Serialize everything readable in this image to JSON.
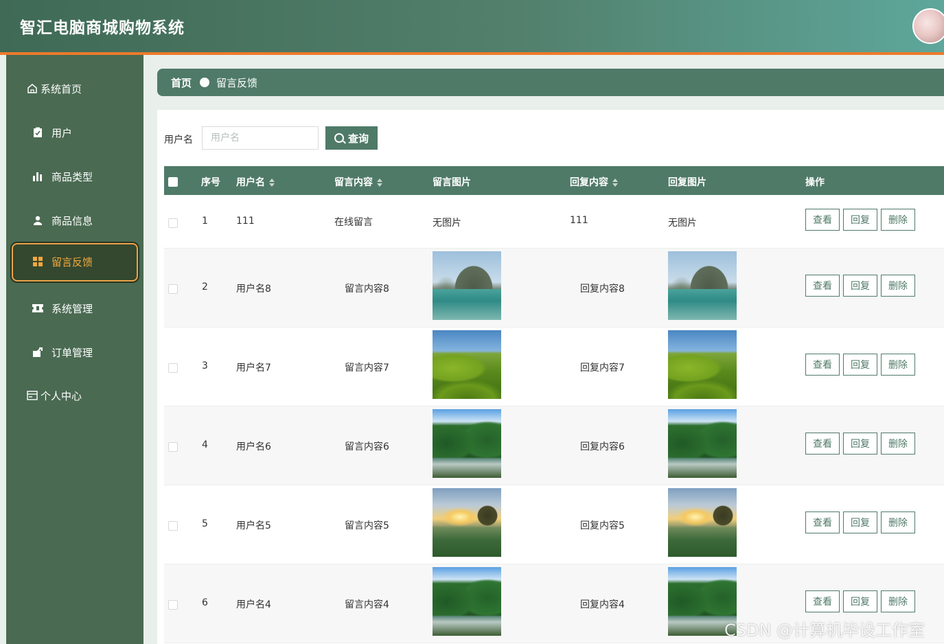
{
  "header": {
    "title": "智汇电脑商城购物系统"
  },
  "sidebar": {
    "items": [
      {
        "label": "系统首页",
        "icon": "home-icon"
      },
      {
        "label": "用户",
        "icon": "clipboard-check-icon"
      },
      {
        "label": "商品类型",
        "icon": "bar-chart-icon"
      },
      {
        "label": "商品信息",
        "icon": "user-stamp-icon"
      },
      {
        "label": "留言反馈",
        "icon": "grid-icon",
        "active": true
      },
      {
        "label": "系统管理",
        "icon": "ticket-icon"
      },
      {
        "label": "订单管理",
        "icon": "share-box-icon"
      },
      {
        "label": "个人中心",
        "icon": "card-icon"
      }
    ]
  },
  "breadcrumb": {
    "home": "首页",
    "current": "留言反馈"
  },
  "search": {
    "label": "用户名",
    "placeholder": "用户名",
    "value": "",
    "button_label": "查询"
  },
  "table": {
    "headers": {
      "index": "序号",
      "username": "用户名",
      "content": "留言内容",
      "image": "留言图片",
      "reply": "回复内容",
      "reply_image": "回复图片",
      "actions": "操作"
    },
    "actions": {
      "view": "查看",
      "reply": "回复",
      "delete": "删除"
    },
    "rows": [
      {
        "index": "1",
        "username": "111",
        "content": "在线留言",
        "image": "无图片",
        "reply": "111",
        "reply_image": "无图片"
      },
      {
        "index": "2",
        "username": "用户名8",
        "content": "留言内容8",
        "image": "lake",
        "reply": "回复内容8",
        "reply_image": "lake"
      },
      {
        "index": "3",
        "username": "用户名7",
        "content": "留言内容7",
        "image": "hill",
        "reply": "回复内容7",
        "reply_image": "hill"
      },
      {
        "index": "4",
        "username": "用户名6",
        "content": "留言内容6",
        "image": "forest",
        "reply": "回复内容6",
        "reply_image": "forest"
      },
      {
        "index": "5",
        "username": "用户名5",
        "content": "留言内容5",
        "image": "sunset",
        "reply": "回复内容5",
        "reply_image": "sunset"
      },
      {
        "index": "6",
        "username": "用户名4",
        "content": "留言内容4",
        "image": "forest",
        "reply": "回复内容4",
        "reply_image": "forest"
      }
    ]
  },
  "watermark": "CSDN @计算机毕设工作室",
  "colors": {
    "primary": "#4f7a68",
    "sidebar": "#4a6a52",
    "accent": "#ee7a2a",
    "active": "#f2a93e"
  }
}
